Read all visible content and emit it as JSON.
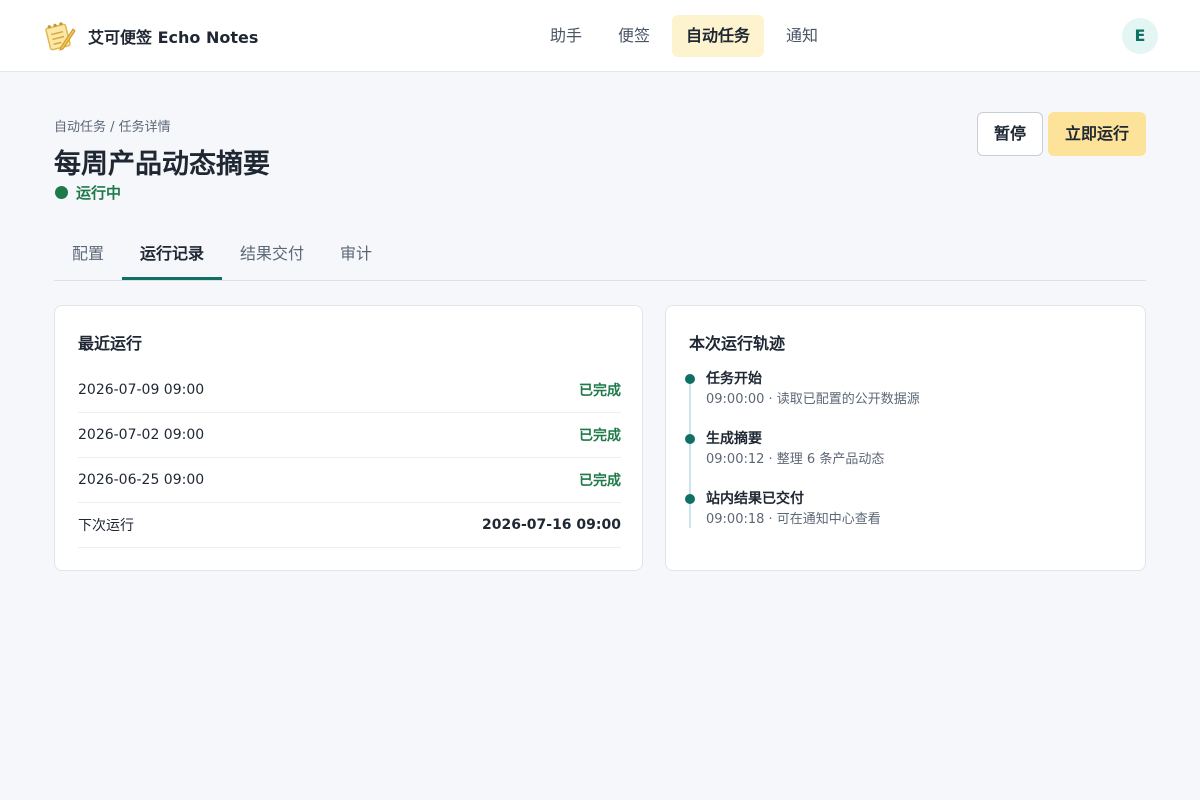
{
  "header": {
    "brand_name": "艾可便签 Echo Notes",
    "logo_icon": "notepad-pencil-icon",
    "nav": [
      {
        "label": "助手"
      },
      {
        "label": "便签"
      },
      {
        "label": "自动任务",
        "active": true
      },
      {
        "label": "通知"
      }
    ],
    "avatar_initial": "E"
  },
  "page": {
    "breadcrumb": "自动任务 / 任务详情",
    "title": "每周产品动态摘要",
    "status": "运行中",
    "actions": {
      "pause_label": "暂停",
      "run_now_label": "立即运行"
    }
  },
  "tabs": [
    {
      "label": "配置"
    },
    {
      "label": "运行记录",
      "active": true
    },
    {
      "label": "结果交付"
    },
    {
      "label": "审计"
    }
  ],
  "recent_runs": {
    "title": "最近运行",
    "rows": [
      {
        "time": "2026-07-09 09:00",
        "status": "已完成"
      },
      {
        "time": "2026-07-02 09:00",
        "status": "已完成"
      },
      {
        "time": "2026-06-25 09:00",
        "status": "已完成"
      }
    ],
    "next_label": "下次运行",
    "next_time": "2026-07-16 09:00"
  },
  "trace": {
    "title": "本次运行轨迹",
    "steps": [
      {
        "title": "任务开始",
        "detail": "09:00:00 · 读取已配置的公开数据源"
      },
      {
        "title": "生成摘要",
        "detail": "09:00:12 · 整理 6 条产品动态"
      },
      {
        "title": "站内结果已交付",
        "detail": "09:00:18 · 可在通知中心查看"
      }
    ]
  },
  "colors": {
    "accent_yellow": "#fde39a",
    "accent_teal": "#0e7164",
    "status_green": "#1f7a4a",
    "background": "#f6f7fb"
  }
}
